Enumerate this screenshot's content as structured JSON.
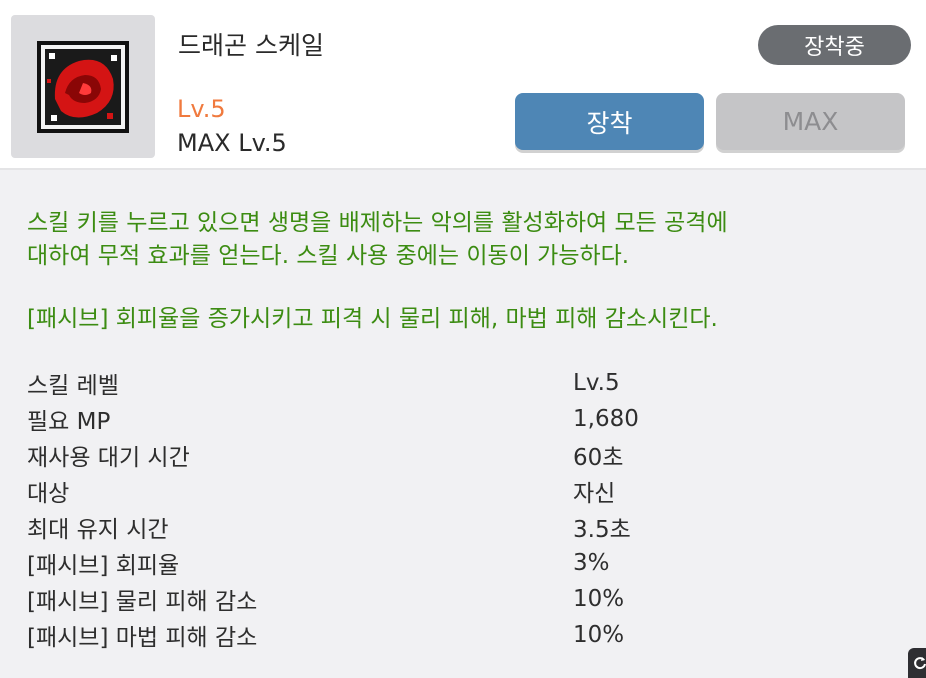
{
  "skill": {
    "name": "드래곤 스케일",
    "current_level": "Lv.5",
    "max_level": "MAX Lv.5",
    "icon": "dragon-skill-icon"
  },
  "actions": {
    "equipped_badge": "장착중",
    "equip_button": "장착",
    "max_button": "MAX"
  },
  "description": {
    "line1": "스킬 키를 누르고 있으면 생명을 배제하는 악의를 활성화하여 모든 공격에",
    "line2": "대하여 무적 효과를 얻는다. 스킬 사용 중에는 이동이 가능하다.",
    "passive": "[패시브] 회피율을 증가시키고 피격 시 물리 피해, 마법 피해 감소시킨다."
  },
  "stats": [
    {
      "label": "스킬 레벨",
      "value": "Lv.5"
    },
    {
      "label": "필요 MP",
      "value": "1,680"
    },
    {
      "label": "재사용 대기 시간",
      "value": "60초"
    },
    {
      "label": "대상",
      "value": "자신"
    },
    {
      "label": "최대 유지 시간",
      "value": "3.5초"
    },
    {
      "label": "[패시브] 회피율",
      "value": "3%"
    },
    {
      "label": "[패시브] 물리 피해 감소",
      "value": "10%"
    },
    {
      "label": "[패시브] 마법 피해 감소",
      "value": "10%"
    }
  ],
  "colors": {
    "accent_blue": "#4e86b5",
    "level_orange": "#f07a3e",
    "description_green": "#3c8c12",
    "badge_gray": "#6a6d71"
  }
}
